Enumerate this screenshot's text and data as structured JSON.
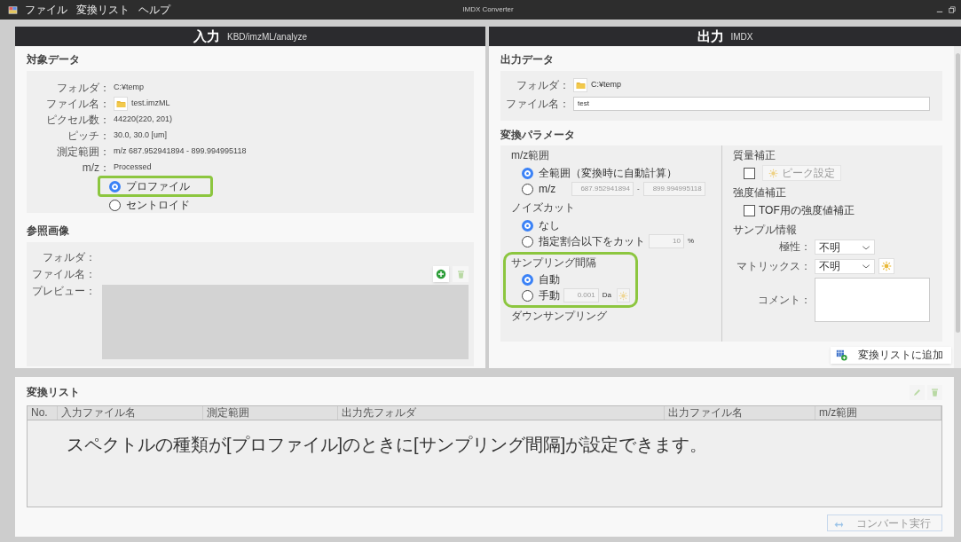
{
  "window": {
    "title": "IMDX Converter",
    "menu": [
      "ファイル",
      "変換リスト",
      "ヘルプ"
    ]
  },
  "input_panel": {
    "title": "入力",
    "subtitle": "KBD/imzML/analyze",
    "target_data": {
      "heading": "対象データ",
      "fields": [
        {
          "label": "フォルダ：",
          "value": "C:¥temp",
          "kind": "text"
        },
        {
          "label": "ファイル名：",
          "value": "test.imzML",
          "kind": "file"
        },
        {
          "label": "ピクセル数：",
          "value": "44220(220, 201)",
          "kind": "text"
        },
        {
          "label": "ピッチ：",
          "value": "30.0, 30.0 [um]",
          "kind": "text"
        },
        {
          "label": "測定範囲：",
          "value": "m/z 687.952941894 - 899.994995118",
          "kind": "text"
        },
        {
          "label": "m/z：",
          "value": "Processed",
          "kind": "text"
        }
      ],
      "options": [
        {
          "label": "プロファイル",
          "selected": true,
          "highlighted": true
        },
        {
          "label": "セントロイド",
          "selected": false,
          "highlighted": false
        }
      ]
    },
    "reference_image": {
      "heading": "参照画像",
      "folder_label": "フォルダ：",
      "file_label": "ファイル名：",
      "preview_label": "プレビュー："
    }
  },
  "output_panel": {
    "title": "出力",
    "subtitle": "IMDX",
    "output_data": {
      "heading": "出力データ",
      "folder_label": "フォルダ：",
      "folder": "C:¥temp",
      "file_label": "ファイル名：",
      "file_name": "test"
    },
    "parameters": {
      "heading": "変換パラメータ",
      "mz_range": {
        "heading": "m/z範囲",
        "options": [
          {
            "label": "全範囲（変換時に自動計算）",
            "selected": true
          },
          {
            "label": "m/z",
            "selected": false
          }
        ],
        "from": "687.952941894",
        "separator": "-",
        "to": "899.994995118"
      },
      "noise_cut": {
        "heading": "ノイズカット",
        "options": [
          {
            "label": "なし",
            "selected": true
          },
          {
            "label": "指定割合以下をカット",
            "selected": false
          }
        ],
        "value": "10",
        "unit": "%"
      },
      "sampling_interval": {
        "heading": "サンプリング間隔",
        "highlighted": true,
        "options": [
          {
            "label": "自動",
            "selected": true
          },
          {
            "label": "手動",
            "selected": false
          }
        ],
        "value": "0.001",
        "unit": "Da"
      },
      "downsampling": {
        "heading": "ダウンサンプリング"
      },
      "mass_correction": {
        "heading": "質量補正",
        "checked": false,
        "button": "ピーク設定",
        "button_disabled": true
      },
      "intensity_correction": {
        "heading": "強度値補正",
        "label": "TOF用の強度値補正",
        "checked": false
      },
      "sample_info": {
        "heading": "サンプル情報",
        "polarity_label": "極性：",
        "polarity": "不明",
        "matrix_label": "マトリックス：",
        "matrix": "不明",
        "comment_label": "コメント："
      }
    },
    "add_button": "変換リストに追加"
  },
  "conversion_list": {
    "heading": "変換リスト",
    "columns": [
      "No.",
      "入力ファイル名",
      "測定範囲",
      "出力先フォルダ",
      "出力ファイル名",
      "m/z範囲"
    ],
    "note": "スペクトルの種類が[プロファイル]のときに[サンプリング間隔]が設定できます。",
    "convert_button": "コンバート実行",
    "convert_disabled": true
  }
}
